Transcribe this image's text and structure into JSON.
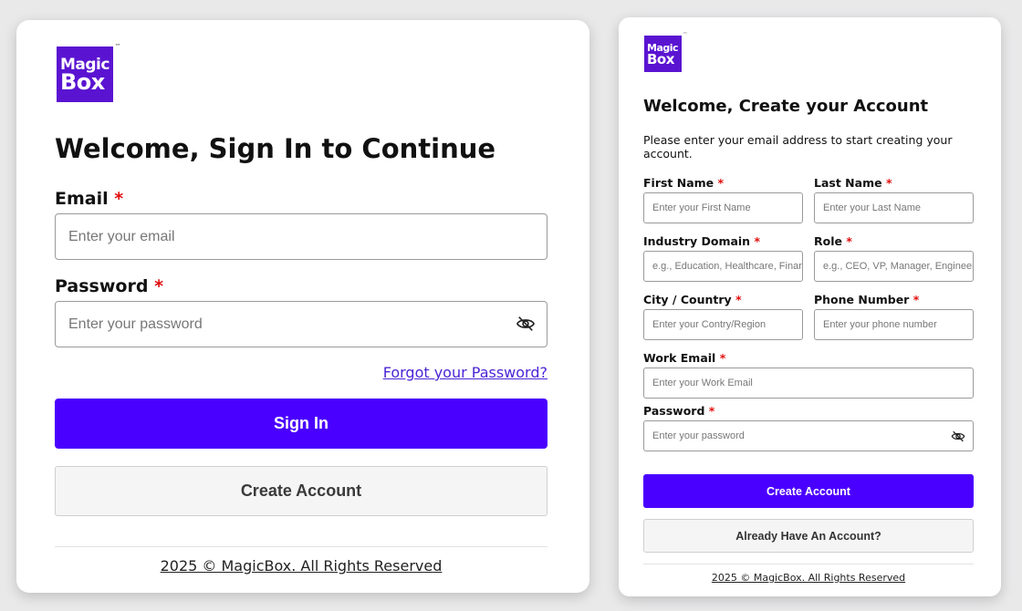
{
  "colors": {
    "brand": "#5a14d1",
    "primary_button": "#4a00ff",
    "required_star": "#e10c0c",
    "link": "#4b25d6"
  },
  "signin": {
    "logo": {
      "line1": "Magic",
      "line2": "Box",
      "tm": "™"
    },
    "title": "Welcome, Sign In to Continue",
    "email_label": "Email",
    "email_placeholder": "Enter your email",
    "password_label": "Password",
    "password_placeholder": "Enter your password",
    "required_mark": "*",
    "forgot_link": "Forgot your Password?",
    "signin_button": "Sign In",
    "create_account_button": "Create Account",
    "footer": "2025 © MagicBox. All Rights Reserved",
    "password_toggle_icon": "eye-slash-icon"
  },
  "signup": {
    "logo": {
      "line1": "Magic",
      "line2": "Box",
      "tm": "™"
    },
    "title": "Welcome, Create your Account",
    "description": "Please enter your email address to start creating your account.",
    "required_mark": "*",
    "fields": {
      "first_name": {
        "label": "First Name",
        "placeholder": "Enter your First Name"
      },
      "last_name": {
        "label": "Last Name",
        "placeholder": "Enter your Last Name"
      },
      "industry": {
        "label": "Industry Domain",
        "placeholder": "e.g., Education, Healthcare, Finance"
      },
      "role": {
        "label": "Role",
        "placeholder": "e.g., CEO, VP, Manager, Engineer"
      },
      "city": {
        "label": "City / Country",
        "placeholder": "Enter your Contry/Region"
      },
      "phone": {
        "label": "Phone Number",
        "placeholder": "Enter your phone number"
      },
      "work_email": {
        "label": "Work Email",
        "placeholder": "Enter your Work Email"
      },
      "password": {
        "label": "Password",
        "placeholder": "Enter your password"
      }
    },
    "create_account_button": "Create Account",
    "already_button": "Already Have An Account?",
    "footer": "2025 © MagicBox. All Rights Reserved",
    "password_toggle_icon": "eye-slash-icon"
  }
}
